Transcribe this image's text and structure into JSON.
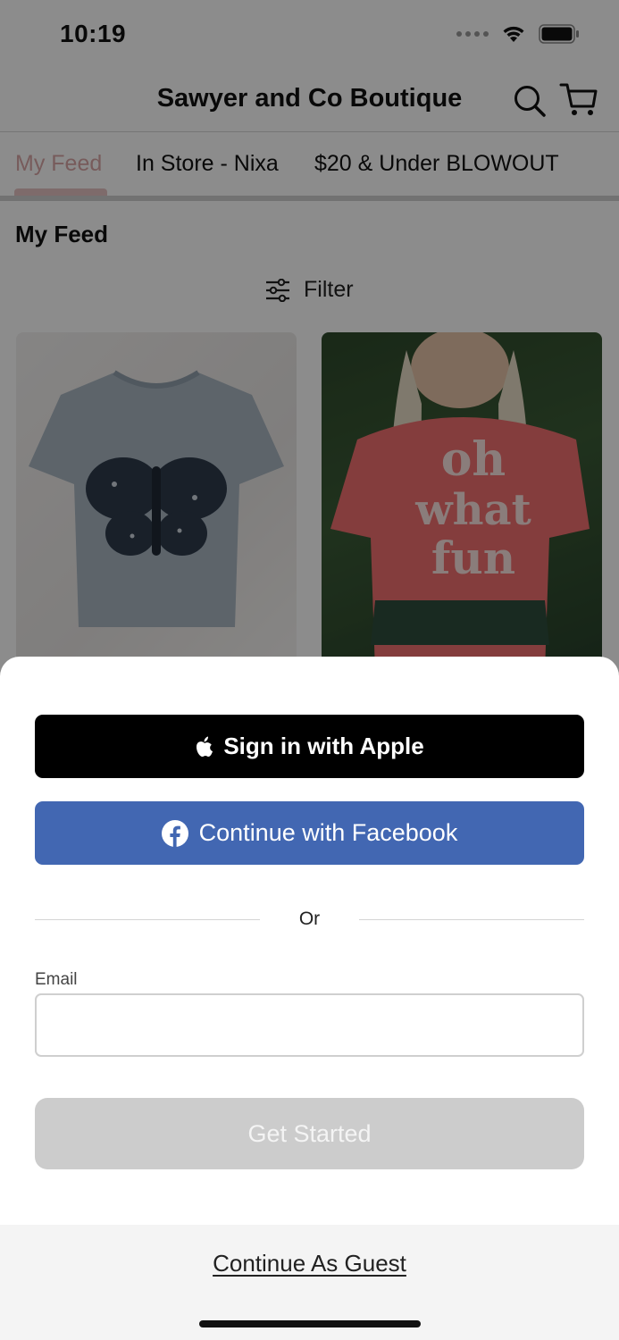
{
  "status_bar": {
    "time": "10:19",
    "icons": [
      "signal-dots-icon",
      "wifi-icon",
      "battery-icon"
    ]
  },
  "header": {
    "title": "Sawyer and Co Boutique",
    "icons": [
      "search-icon",
      "cart-icon"
    ]
  },
  "tabs": [
    {
      "label": "My Feed",
      "active": true
    },
    {
      "label": "In Store - Nixa",
      "active": false
    },
    {
      "label": "$20 & Under BLOWOUT",
      "active": false
    }
  ],
  "feed": {
    "section_title": "My Feed",
    "filter_label": "Filter",
    "products": [
      {
        "image": "gray t-shirt with butterfly graphic"
      },
      {
        "image": "pink t-shirt with 'oh what fun' graphic"
      }
    ]
  },
  "signin_sheet": {
    "apple_label": "Sign in with Apple",
    "facebook_label": "Continue with Facebook",
    "divider_text": "Or",
    "email_label": "Email",
    "email_value": "",
    "email_placeholder": "",
    "get_started_label": "Get Started",
    "guest_label": "Continue As Guest"
  },
  "colors": {
    "facebook_blue": "#4267b2",
    "apple_black": "#000000",
    "disabled_button": "#cccccc",
    "active_tab": "#d9a7a7",
    "guest_bar": "#f4f4f4"
  }
}
